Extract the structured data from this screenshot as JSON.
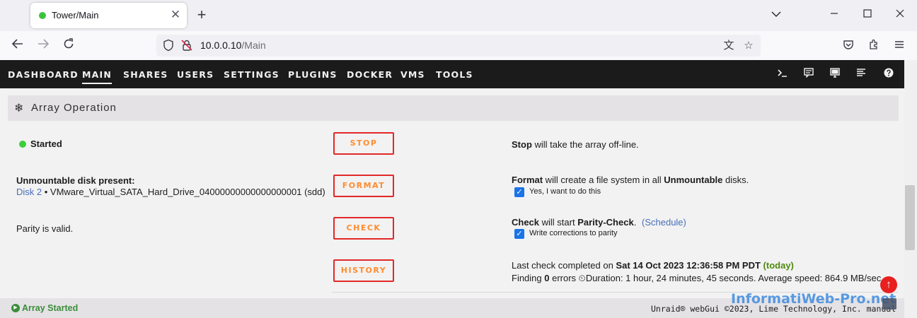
{
  "browser": {
    "tab_title": "Tower/Main",
    "url_host": "10.0.0.10",
    "url_path": "/Main"
  },
  "menu": {
    "items": [
      "DASHBOARD",
      "MAIN",
      "SHARES",
      "USERS",
      "SETTINGS",
      "PLUGINS",
      "DOCKER",
      "VMS",
      "TOOLS"
    ],
    "active": "MAIN"
  },
  "section": {
    "title": "Array Operation"
  },
  "array": {
    "status": "Started",
    "unmountable_label": "Unmountable disk present:",
    "disk_link": "Disk 2",
    "disk_detail": " • VMware_Virtual_SATA_Hard_Drive_04000000000000000001 (sdd)",
    "parity_status": "Parity is valid."
  },
  "buttons": {
    "stop": "STOP",
    "format": "FORMAT",
    "check": "CHECK",
    "history": "HISTORY"
  },
  "descriptions": {
    "stop_bold": "Stop",
    "stop_rest": " will take the array off-line.",
    "format_bold": "Format",
    "format_mid": " will create a file system in all ",
    "format_bold2": "Unmountable",
    "format_end": " disks.",
    "format_checkbox": "Yes, I want to do this",
    "check_bold": "Check",
    "check_mid": " will start ",
    "check_bold2": "Parity-Check",
    "check_end": ".",
    "schedule_link": "(Schedule)",
    "check_checkbox": "Write corrections to parity",
    "last_check_prefix": "Last check completed on ",
    "last_check_date": "Sat 14 Oct 2023 12:36:58 PM PDT",
    "last_check_today": "(today)",
    "finding_prefix": "Finding ",
    "finding_count": "0",
    "finding_suffix": " errors",
    "duration": "Duration: 1 hour, 24 minutes, 45 seconds. Average speed: 864.9 MB/sec"
  },
  "footer": {
    "status": "Array Started",
    "copyright": "Unraid® webGui ©2023, Lime Technology, Inc. manual"
  },
  "watermark": {
    "text": "InformatiWeb-Pro.net"
  },
  "colors": {
    "menu_bg": "#1c1b1b",
    "button_border": "#e22828",
    "button_text": "#ff8c2f",
    "status_green": "#3bce3b",
    "link_blue": "#486dba"
  }
}
